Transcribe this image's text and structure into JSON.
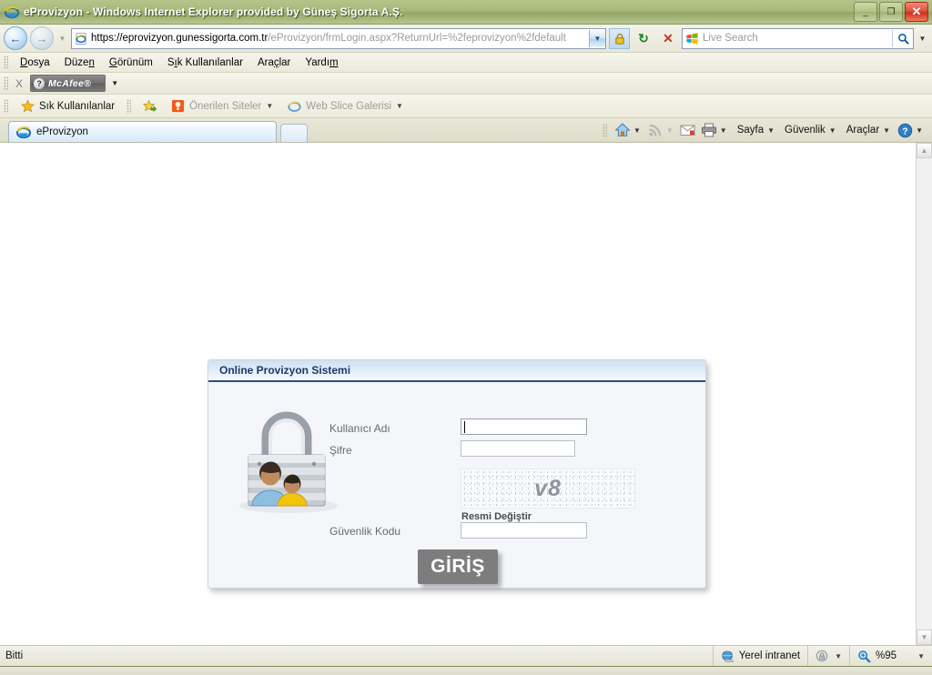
{
  "window": {
    "title": "eProvizyon - Windows Internet Explorer provided by Güneş Sigorta A.Ş.",
    "minimize_label": "_",
    "restore_label": "❐",
    "close_label": "✕"
  },
  "navigation": {
    "back_label": "←",
    "forward_label": "→",
    "history_caret": "▼",
    "url_secure": "https://eprovizyon.gunessigorta.com.tr",
    "url_path": "/eProvizyon/frmLogin.aspx?ReturnUrl=%2feprovizyon%2fdefault",
    "address_dropdown_caret": "▼",
    "refresh_label": "↻",
    "stop_label": "✕",
    "search_placeholder": "Live Search",
    "search_go_label": "🔍",
    "search_dropdown_caret": "▼"
  },
  "menubar": {
    "items": [
      {
        "pre": "",
        "accel": "D",
        "post": "osya"
      },
      {
        "pre": "Düze",
        "accel": "n",
        "post": ""
      },
      {
        "pre": "",
        "accel": "G",
        "post": "örünüm"
      },
      {
        "pre": "S",
        "accel": "ı",
        "post": "k Kullanılanlar"
      },
      {
        "pre": "Ara",
        "accel": "ç",
        "post": "lar"
      },
      {
        "pre": "Yardı",
        "accel": "m",
        "post": ""
      }
    ]
  },
  "mcafee_bar": {
    "close_label": "X",
    "shield_glyph": "?",
    "label": "McAfee®",
    "caret": "▼"
  },
  "favorites_bar": {
    "favorites_label": "Sık Kullanılanlar",
    "suggested_sites_label": "Önerilen Siteler",
    "web_slice_label": "Web Slice Galerisi",
    "caret": "▼"
  },
  "tabs": {
    "active_tab_label": "eProvizyon",
    "new_tab_label": ""
  },
  "command_bar": {
    "home_label": "🏠",
    "home_caret": "▼",
    "feeds_label": "📡",
    "feeds_caret": "▼",
    "mail_label": "✉",
    "print_label": "🖨",
    "print_caret": "▼",
    "page_label": "Sayfa",
    "page_caret": "▼",
    "security_label": "Güvenlik",
    "security_caret": "▼",
    "tools_label": "Araçlar",
    "tools_caret": "▼",
    "help_label": "?",
    "help_caret": "▼"
  },
  "page": {
    "panel_title": "Online Provizyon Sistemi",
    "username_label": "Kullanıcı Adı",
    "username_value": "",
    "password_label": "Şifre",
    "password_value": "",
    "captcha_text": "v8",
    "captcha_refresh_label": "Resmi Değiştir",
    "security_code_label": "Güvenlik Kodu",
    "security_code_value": "",
    "submit_label": "GİRİŞ"
  },
  "scrollbar": {
    "up_label": "▲",
    "down_label": "▼"
  },
  "statusbar": {
    "status_text": "Bitti",
    "zone_label": "Yerel intranet",
    "protected_caret": "▼",
    "zoom_label": "%95",
    "zoom_caret": "▼"
  },
  "colors": {
    "titlebar_green": "#a8b87a",
    "panel_header_blue": "#2b4f80",
    "panel_title_text": "#1b3a66",
    "submit_gray": "#7d7d7d",
    "close_red": "#c9301c"
  }
}
